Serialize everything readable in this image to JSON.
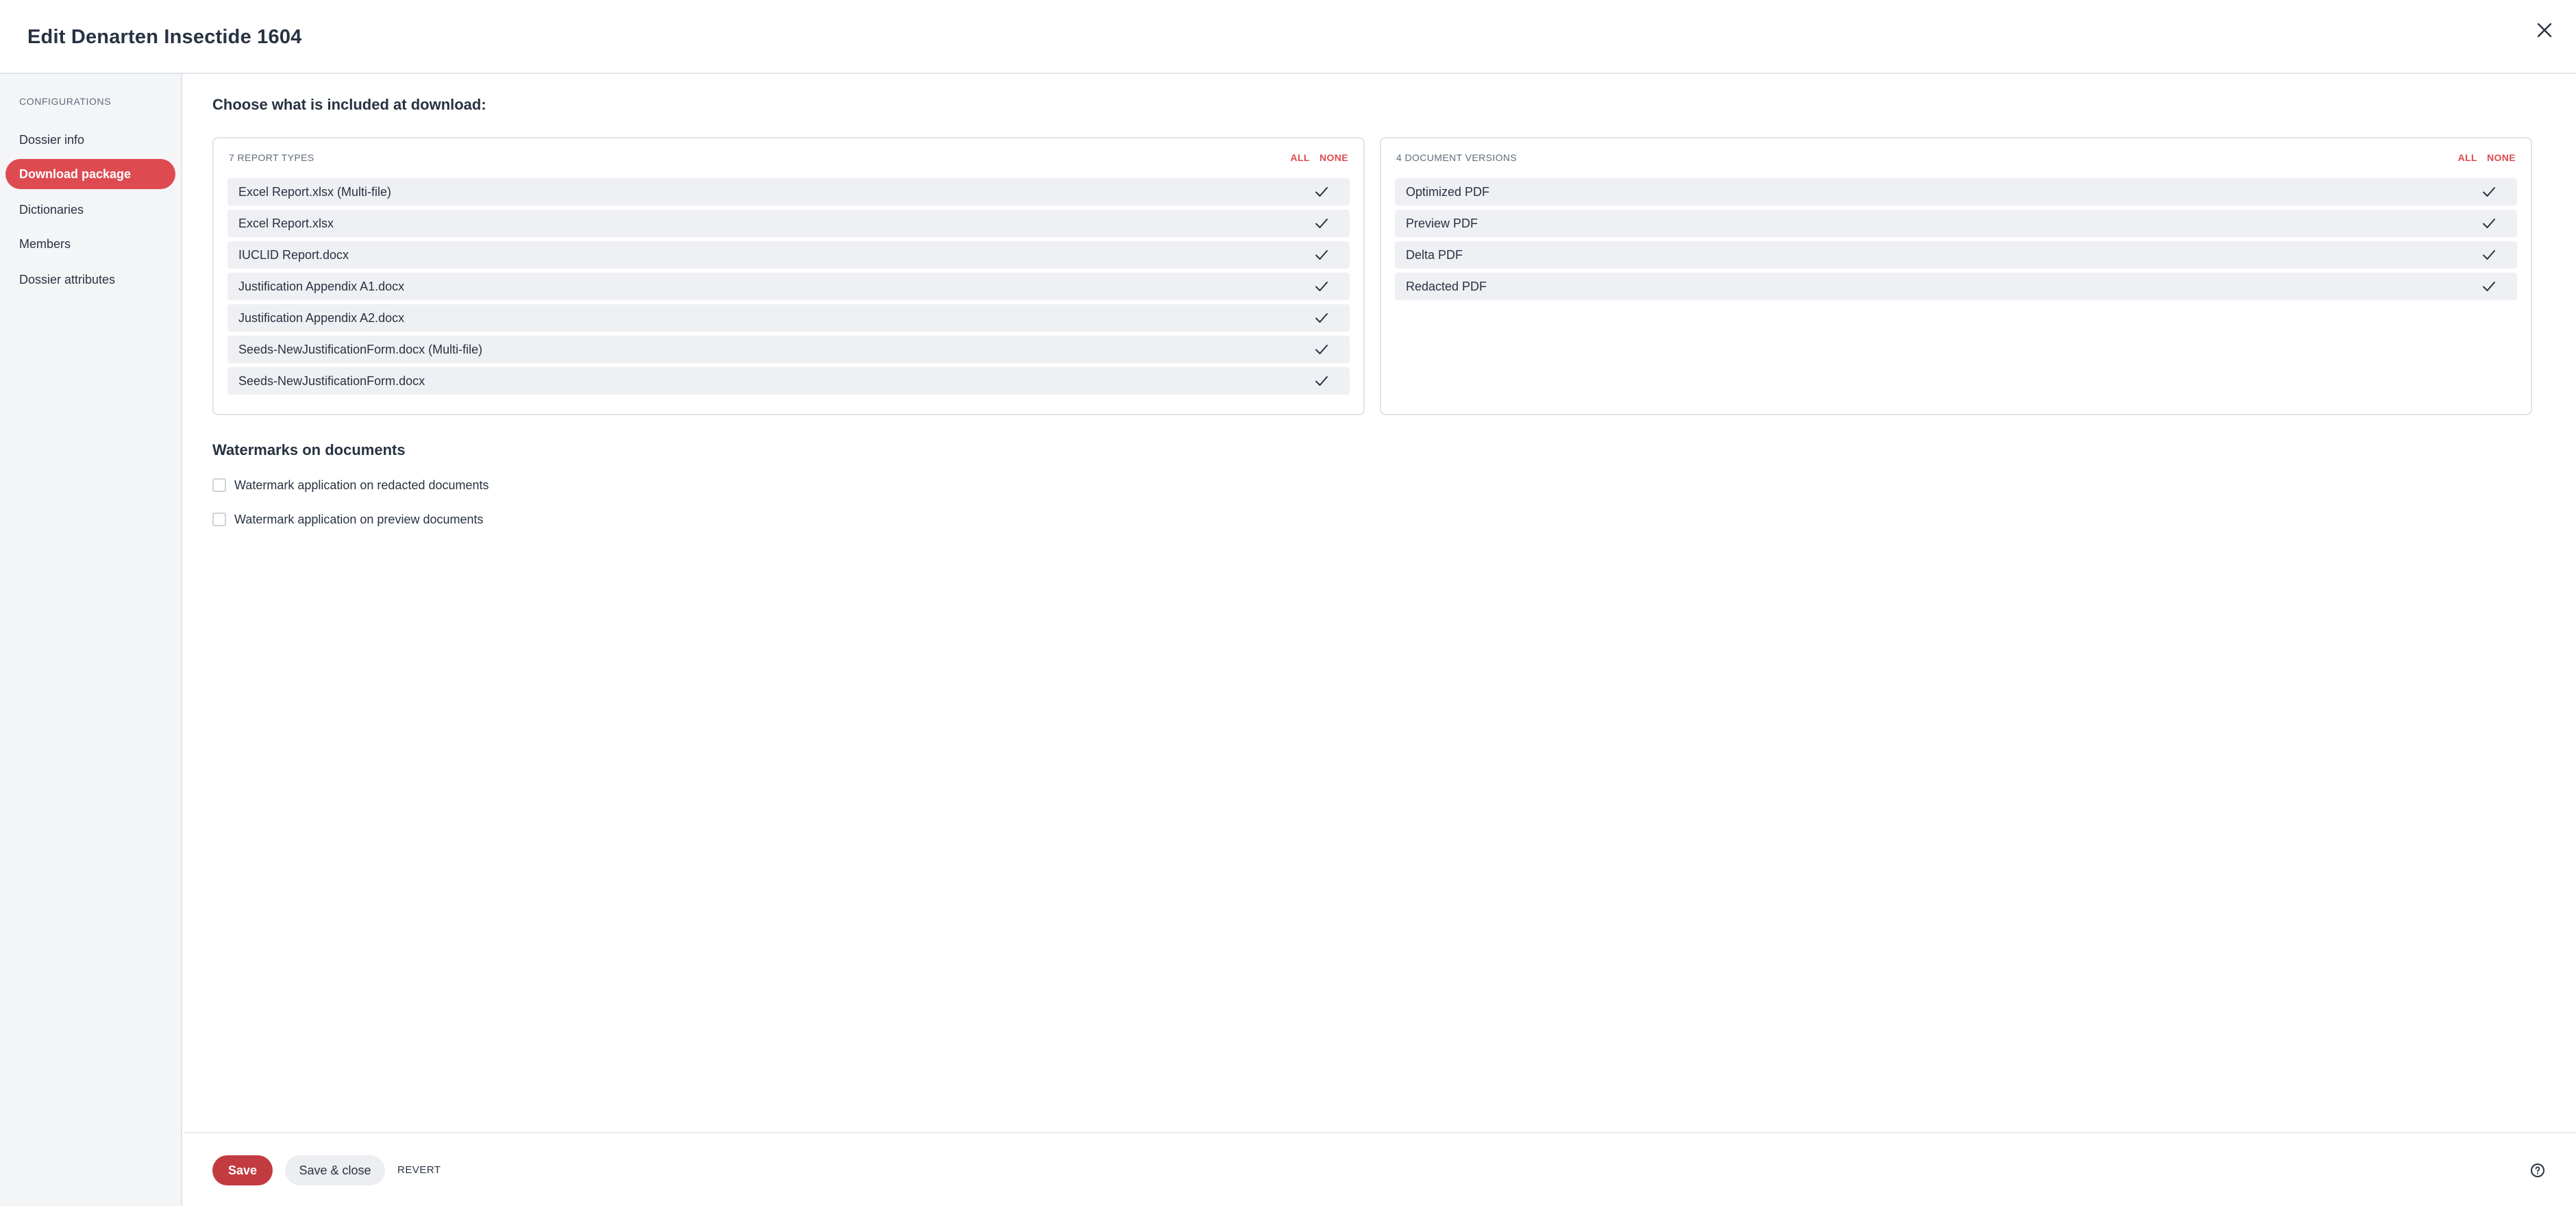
{
  "header": {
    "title": "Edit Denarten Insectide 1604",
    "close_icon": "close-icon"
  },
  "sidebar": {
    "section_label": "CONFIGURATIONS",
    "items": [
      {
        "label": "Dossier info",
        "active": false
      },
      {
        "label": "Download package",
        "active": true
      },
      {
        "label": "Dictionaries",
        "active": false
      },
      {
        "label": "Members",
        "active": false
      },
      {
        "label": "Dossier attributes",
        "active": false
      }
    ]
  },
  "main": {
    "title": "Choose what is included at download:",
    "report_types": {
      "label": "7 REPORT TYPES",
      "all_label": "ALL",
      "none_label": "NONE",
      "items": [
        {
          "label": "Excel Report.xlsx (Multi-file)",
          "checked": true
        },
        {
          "label": "Excel Report.xlsx",
          "checked": true
        },
        {
          "label": "IUCLID Report.docx",
          "checked": true
        },
        {
          "label": "Justification Appendix A1.docx",
          "checked": true
        },
        {
          "label": "Justification Appendix A2.docx",
          "checked": true
        },
        {
          "label": "Seeds-NewJustificationForm.docx (Multi-file)",
          "checked": true
        },
        {
          "label": "Seeds-NewJustificationForm.docx",
          "checked": true
        }
      ]
    },
    "document_versions": {
      "label": "4 DOCUMENT VERSIONS",
      "all_label": "ALL",
      "none_label": "NONE",
      "items": [
        {
          "label": "Optimized PDF",
          "checked": true
        },
        {
          "label": "Preview PDF",
          "checked": true
        },
        {
          "label": "Delta PDF",
          "checked": true
        },
        {
          "label": "Redacted PDF",
          "checked": true
        }
      ]
    },
    "watermarks": {
      "title": "Watermarks on documents",
      "options": [
        {
          "label": "Watermark application on redacted documents",
          "checked": false
        },
        {
          "label": "Watermark application on preview documents",
          "checked": false
        }
      ]
    }
  },
  "footer": {
    "save_label": "Save",
    "save_close_label": "Save & close",
    "revert_label": "REVERT",
    "help_icon": "help-circle-icon"
  },
  "colors": {
    "accent": "#dd4b51",
    "save_button": "#c23b41",
    "row_bg": "#eff0f3",
    "sidebar_bg": "#f4f5f7",
    "text": "#283241"
  }
}
